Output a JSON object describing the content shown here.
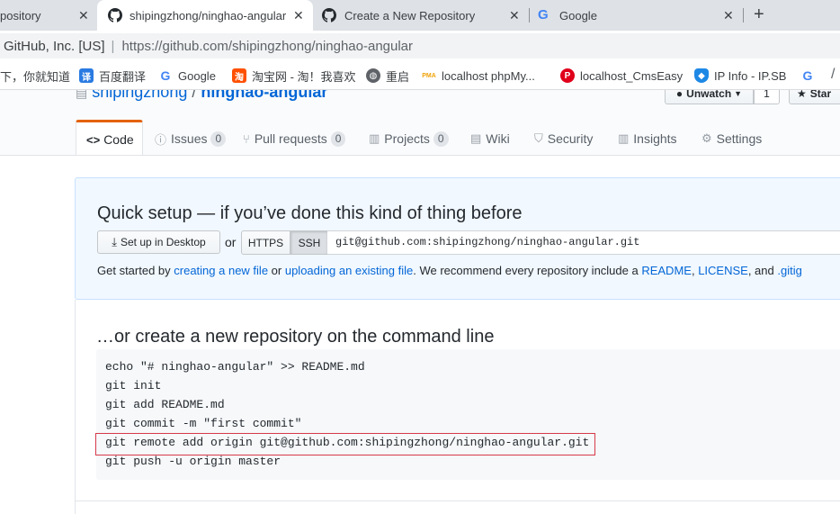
{
  "tabs": [
    {
      "title": "pository",
      "close": "✕"
    },
    {
      "title": "shipingzhong/ninghao-angular",
      "close": "✕"
    },
    {
      "title": "Create a New Repository",
      "close": "✕"
    },
    {
      "title": "Google",
      "close": "✕"
    }
  ],
  "new_tab": "+",
  "address": {
    "site_identity": "GitHub, Inc. [US]",
    "separator": "|",
    "url_host": "https://github.com/",
    "url_path": "shipingzhong/ninghao-angular"
  },
  "bookmarks": [
    {
      "label": "下，你就知道"
    },
    {
      "label": "百度翻译",
      "icon": "译"
    },
    {
      "label": "Google",
      "icon": "G"
    },
    {
      "label": "淘宝网 - 淘！我喜欢",
      "icon": "淘"
    },
    {
      "label": "重启",
      "icon": "globe"
    },
    {
      "label": "localhost phpMy...",
      "icon": "PMA"
    },
    {
      "label": "localhost_CmsEasy",
      "icon": "P"
    },
    {
      "label": "IP Info - IP.SB",
      "icon": "shield"
    },
    {
      "label": "",
      "icon": "G"
    }
  ],
  "repo": {
    "owner": "shipingzhong",
    "slash": "/",
    "name": "ninghao-angular",
    "unwatch_label": "Unwatch",
    "watch_count": "1",
    "star_label": "Star"
  },
  "repo_tabs": [
    {
      "label": "Code"
    },
    {
      "label": "Issues",
      "count": "0"
    },
    {
      "label": "Pull requests",
      "count": "0"
    },
    {
      "label": "Projects",
      "count": "0"
    },
    {
      "label": "Wiki"
    },
    {
      "label": "Security"
    },
    {
      "label": "Insights"
    },
    {
      "label": "Settings"
    }
  ],
  "quick_setup": {
    "title": "Quick setup — if you’ve done this kind of thing before",
    "desktop_button": "Set up in Desktop",
    "or": "or",
    "https_label": "HTTPS",
    "ssh_label": "SSH",
    "clone_url": "git@github.com:shipingzhong/ninghao-angular.git",
    "help_prefix": "Get started by ",
    "help_link1": "creating a new file",
    "help_mid1": " or ",
    "help_link2": "uploading an existing file",
    "help_mid2": ". We recommend every repository include a ",
    "help_link3": "README",
    "help_comma": ", ",
    "help_link4": "LICENSE",
    "help_and": ", and ",
    "help_link5": ".gitig"
  },
  "command_line": {
    "title": "…or create a new repository on the command line",
    "lines": [
      "echo \"# ninghao-angular\" >> README.md",
      "git init",
      "git add README.md",
      "git commit -m \"first commit\"",
      "git remote add origin git@github.com:shipingzhong/ninghao-angular.git",
      "git push -u origin master"
    ],
    "highlight_color": "#d73a49"
  }
}
